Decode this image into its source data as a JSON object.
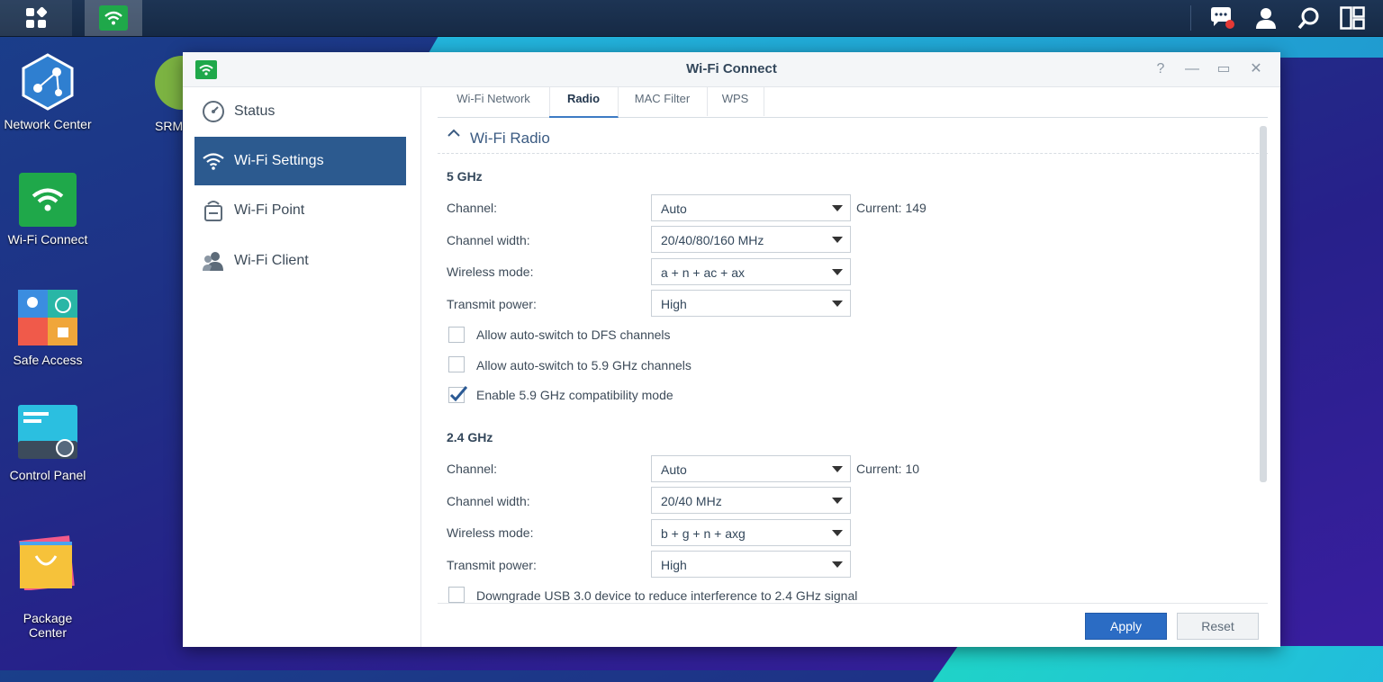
{
  "desktop": {
    "icons": [
      {
        "label": "Network Center"
      },
      {
        "label": "Wi-Fi Connect"
      },
      {
        "label": "Safe Access"
      },
      {
        "label": "Control Panel"
      },
      {
        "label": "Package\nCenter"
      },
      {
        "label": "SRM"
      }
    ]
  },
  "window": {
    "title": "Wi-Fi Connect",
    "controls": {
      "help": "?",
      "minimize": "—",
      "maximize": "▭",
      "close": "✕"
    }
  },
  "sidebar": {
    "items": [
      {
        "label": "Status",
        "icon": "gauge-icon"
      },
      {
        "label": "Wi-Fi Settings",
        "icon": "wifi-icon",
        "active": true
      },
      {
        "label": "Wi-Fi Point",
        "icon": "router-icon"
      },
      {
        "label": "Wi-Fi Client",
        "icon": "users-icon"
      }
    ]
  },
  "tabs": [
    {
      "label": "Wi-Fi Network"
    },
    {
      "label": "Radio",
      "active": true
    },
    {
      "label": "MAC Filter"
    },
    {
      "label": "WPS"
    }
  ],
  "section": {
    "title": "Wi-Fi Radio"
  },
  "band5": {
    "title": "5 GHz",
    "channel": {
      "label": "Channel:",
      "value": "Auto",
      "current": "Current: 149"
    },
    "width": {
      "label": "Channel width:",
      "value": "20/40/80/160 MHz"
    },
    "mode": {
      "label": "Wireless mode:",
      "value": "a + n + ac + ax"
    },
    "power": {
      "label": "Transmit power:",
      "value": "High"
    },
    "dfs": {
      "label": "Allow auto-switch to DFS channels",
      "checked": false
    },
    "ch59": {
      "label": "Allow auto-switch to 5.9 GHz channels",
      "checked": false
    },
    "compat": {
      "label": "Enable 5.9 GHz compatibility mode",
      "checked": true
    }
  },
  "band24": {
    "title": "2.4 GHz",
    "channel": {
      "label": "Channel:",
      "value": "Auto",
      "current": "Current: 10"
    },
    "width": {
      "label": "Channel width:",
      "value": "20/40 MHz"
    },
    "mode": {
      "label": "Wireless mode:",
      "value": "b + g + n + axg"
    },
    "power": {
      "label": "Transmit power:",
      "value": "High"
    },
    "usb": {
      "label": "Downgrade USB 3.0 device to reduce interference to 2.4 GHz signal",
      "checked": false
    }
  },
  "footer": {
    "apply": "Apply",
    "reset": "Reset"
  },
  "colors": {
    "accent": "#2b6cc4",
    "sidebar_active": "#2c5a8f",
    "wifi_green": "#1fa84a"
  }
}
